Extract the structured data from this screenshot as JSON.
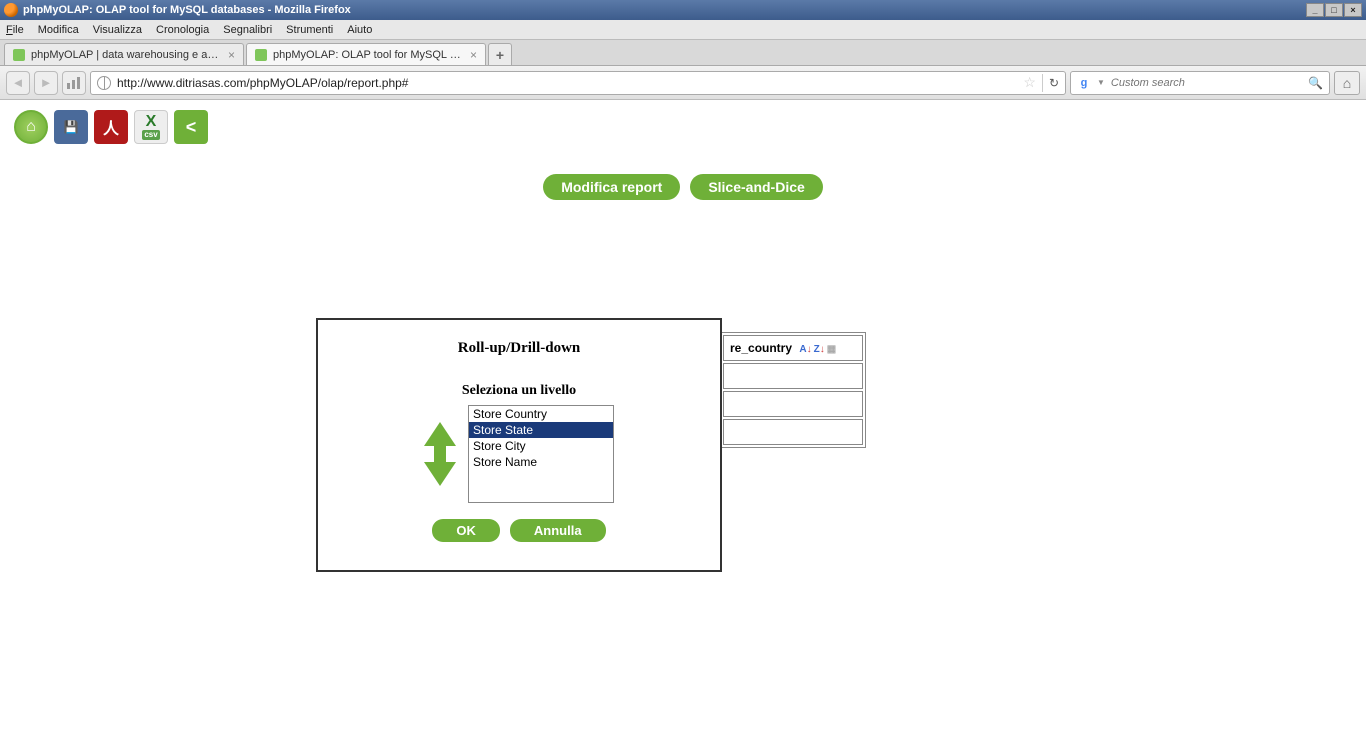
{
  "window": {
    "title": "phpMyOLAP: OLAP tool for MySQL databases - Mozilla Firefox"
  },
  "menu": {
    "file": "File",
    "edit": "Modifica",
    "view": "Visualizza",
    "history": "Cronologia",
    "bookmarks": "Segnalibri",
    "tools": "Strumenti",
    "help": "Aiuto"
  },
  "tabs": [
    {
      "label": "phpMyOLAP | data warehousing e analisi ...",
      "active": false
    },
    {
      "label": "phpMyOLAP: OLAP tool for MySQL datab...",
      "active": true
    }
  ],
  "nav": {
    "url": "http://www.ditriasas.com/phpMyOLAP/olap/report.php#",
    "search_placeholder": "Custom search"
  },
  "toolbar": {
    "home_label": "Home",
    "save_label": "Save",
    "pdf_label": "PDF",
    "csv_label": "csv",
    "share_label": "Share"
  },
  "report": {
    "modify_btn": "Modifica report",
    "slice_btn": "Slice-and-Dice"
  },
  "bg_table": {
    "header_col": "re_country"
  },
  "dialog": {
    "title": "Roll-up/Drill-down",
    "subtitle": "Seleziona un livello",
    "levels": [
      "Store Country",
      "Store State",
      "Store City",
      "Store Name"
    ],
    "selected_index": 1,
    "ok": "OK",
    "cancel": "Annulla"
  }
}
